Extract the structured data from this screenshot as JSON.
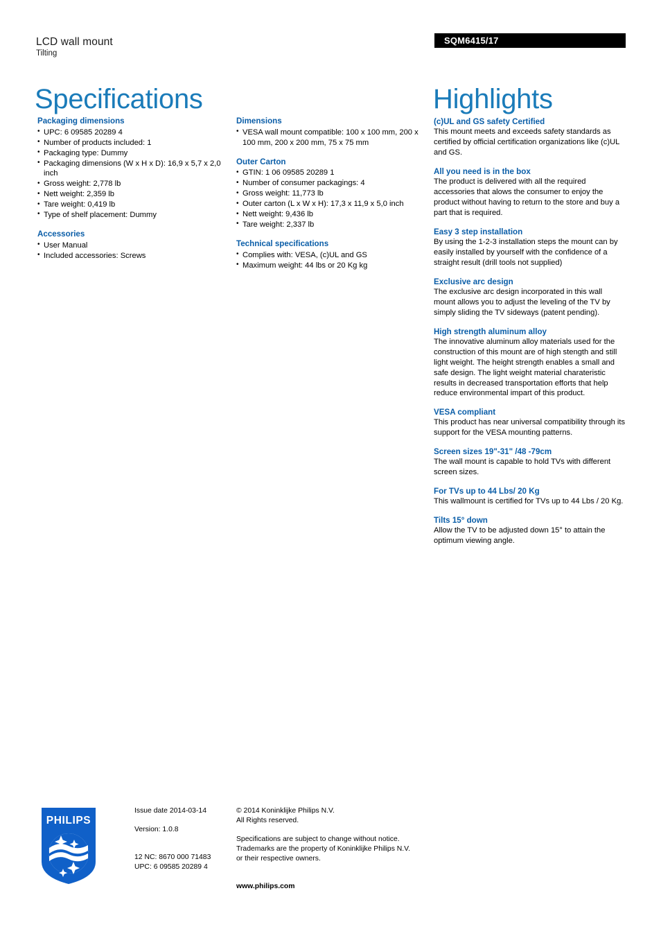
{
  "header": {
    "product_title": "LCD wall mount",
    "product_subtitle": "Tilting",
    "product_code": "SQM6415/17",
    "specifications_heading": "Specifications",
    "highlights_heading": "Highlights"
  },
  "colors": {
    "title_blue": "#1a7bb9",
    "heading_blue": "#0b5ea8",
    "logo_blue": "#1060c8",
    "code_bar_bg": "#000000"
  },
  "spec_columns": [
    {
      "groups": [
        {
          "heading": "Packaging dimensions",
          "items": [
            "UPC: 6 09585 20289 4",
            "Number of products included: 1",
            "Packaging type: Dummy",
            "Packaging dimensions (W x H x D): 16,9 x 5,7 x 2,0 inch",
            "Gross weight: 2,778 lb",
            "Nett weight: 2,359 lb",
            "Tare weight: 0,419 lb",
            "Type of shelf placement: Dummy"
          ]
        },
        {
          "heading": "Accessories",
          "items": [
            "User Manual",
            "Included accessories: Screws"
          ]
        }
      ]
    },
    {
      "groups": [
        {
          "heading": "Dimensions",
          "items": [
            "VESA wall mount compatible: 100 x 100 mm, 200 x 100 mm, 200 x 200 mm, 75 x 75 mm"
          ]
        },
        {
          "heading": "Outer Carton",
          "items": [
            "GTIN: 1 06 09585 20289 1",
            "Number of consumer packagings: 4",
            "Gross weight: 11,773 lb",
            "Outer carton (L x W x H): 17,3 x 11,9 x 5,0 inch",
            "Nett weight: 9,436 lb",
            "Tare weight: 2,337 lb"
          ]
        },
        {
          "heading": "Technical specifications",
          "items": [
            "Complies with: VESA, (c)UL and GS",
            "Maximum weight: 44 lbs or 20 Kg kg"
          ]
        }
      ]
    }
  ],
  "highlights": [
    {
      "title": "(c)UL and GS safety Certified",
      "body": "This mount meets and exceeds safety standards as certified by official certification organizations like (c)UL and GS."
    },
    {
      "title": "All you need is in the box",
      "body": "The product is delivered with all the required accessories that alows the consumer to enjoy the product without having to return to the store and buy a part that is required."
    },
    {
      "title": "Easy 3 step installation",
      "body": "By using the 1-2-3 installation steps the mount can by easily installed by yourself with the confidence of a straight result (drill tools not supplied)"
    },
    {
      "title": "Exclusive arc design",
      "body": "The exclusive arc design incorporated in this wall mount allows you to adjust the leveling of the TV by simply sliding the TV sideways (patent pending)."
    },
    {
      "title": "High strength aluminum alloy",
      "body": "The innovative aluminum alloy materials used for the construction of this mount are of high stength and still light weight. The height strength enables a small and safe design. The light weight material charateristic results in decreased transportation efforts that help reduce environmental impart of this product."
    },
    {
      "title": "VESA compliant",
      "body": "This product has near universal compatibility through its support for the VESA mounting patterns."
    },
    {
      "title": "Screen sizes 19\"-31\" /48 -79cm",
      "body": "The wall mount is capable to hold TVs with different screen sizes."
    },
    {
      "title": "For TVs up to 44 Lbs/ 20 Kg",
      "body": "This wallmount is certified for TVs up to 44 Lbs / 20 Kg."
    },
    {
      "title": "Tilts 15° down",
      "body": "Allow the TV to be adjusted down 15° to attain the optimum viewing angle."
    }
  ],
  "footer": {
    "logo_wordmark": "PHILIPS",
    "issue_date": "Issue date 2014-03-14",
    "version": "Version: 1.0.8",
    "twelve_nc": "12 NC: 8670 000 71483",
    "upc": "UPC: 6 09585 20289 4",
    "copyright_line1": "© 2014 Koninklijke Philips N.V.",
    "copyright_line2": "All Rights reserved.",
    "disclaimer_line1": "Specifications are subject to change without notice.",
    "disclaimer_line2": "Trademarks are the property of Koninklijke Philips N.V.",
    "disclaimer_line3": "or their respective owners.",
    "website": "www.philips.com"
  }
}
